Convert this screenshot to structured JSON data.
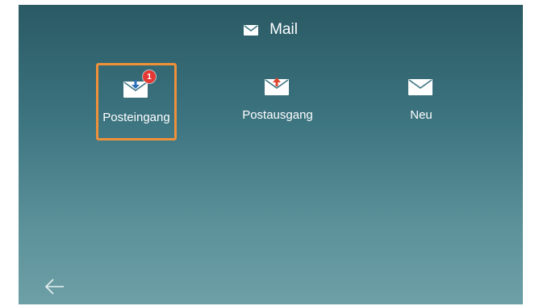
{
  "header": {
    "title": "Mail",
    "icon": "mail-icon"
  },
  "tiles": [
    {
      "label": "Posteingang",
      "icon": "inbox-mail-icon",
      "badge": "1",
      "selected": true
    },
    {
      "label": "Postausgang",
      "icon": "outbox-mail-icon",
      "selected": false
    },
    {
      "label": "Neu",
      "icon": "new-mail-icon",
      "selected": false
    }
  ],
  "footer": {
    "back_icon": "back-arrow-icon"
  },
  "colors": {
    "accent": "#f0913a",
    "badge": "#e53935",
    "inbox_arrow": "#2a6fb8",
    "outbox_arrow": "#e0452d"
  }
}
